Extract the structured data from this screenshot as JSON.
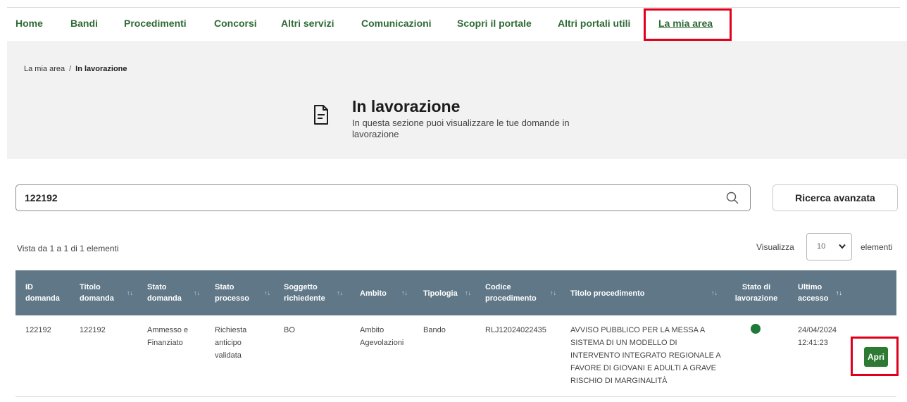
{
  "nav": {
    "items": [
      {
        "label": "Home"
      },
      {
        "label": "Bandi"
      },
      {
        "label": "Procedimenti"
      },
      {
        "label": "Concorsi"
      },
      {
        "label": "Altri servizi"
      },
      {
        "label": "Comunicazioni"
      },
      {
        "label": "Scopri il portale"
      },
      {
        "label": "Altri portali utili"
      },
      {
        "label": "La mia area"
      }
    ],
    "active": "La mia area"
  },
  "breadcrumb": {
    "parent": "La mia area",
    "separator": "/",
    "current": "In lavorazione"
  },
  "hero": {
    "icon": "document-icon",
    "title": "In lavorazione",
    "subtitle": "In questa sezione puoi visualizzare le tue domande in lavorazione"
  },
  "search": {
    "value": "122192",
    "icon": "search-icon"
  },
  "advanced_search_label": "Ricerca avanzata",
  "pagination": {
    "info": "Vista da 1 a 1 di 1 elementi",
    "show_label": "Visualizza",
    "page_size": "10",
    "elements_label": "elementi"
  },
  "table": {
    "headers": [
      "ID domanda",
      "Titolo domanda",
      "Stato domanda",
      "Stato processo",
      "Soggetto richiedente",
      "Ambito",
      "Tipologia",
      "Codice procedimento",
      "Titolo procedimento",
      "Stato di lavorazione",
      "Ultimo accesso"
    ],
    "rows": [
      {
        "id": "122192",
        "titolo": "122192",
        "stato_domanda": "Ammesso e Finanziato",
        "stato_processo": "Richiesta anticipo validata",
        "soggetto": "BO",
        "ambito": "Ambito Agevolazioni",
        "tipologia": "Bando",
        "codice": "RLJ12024022435",
        "titolo_proc": "AVVISO PUBBLICO PER LA MESSA A SISTEMA DI UN MODELLO DI INTERVENTO INTEGRATO REGIONALE A FAVORE DI GIOVANI E ADULTI A GRAVE RISCHIO DI MARGINALITÀ",
        "stato_lavorazione_color": "#1f7a3a",
        "ultimo_accesso": "24/04/2024 12:41:23",
        "action_label": "Apri"
      }
    ]
  },
  "colors": {
    "brand_green": "#2d6a34",
    "table_header": "#5f7787",
    "highlight": "#e0001b"
  }
}
